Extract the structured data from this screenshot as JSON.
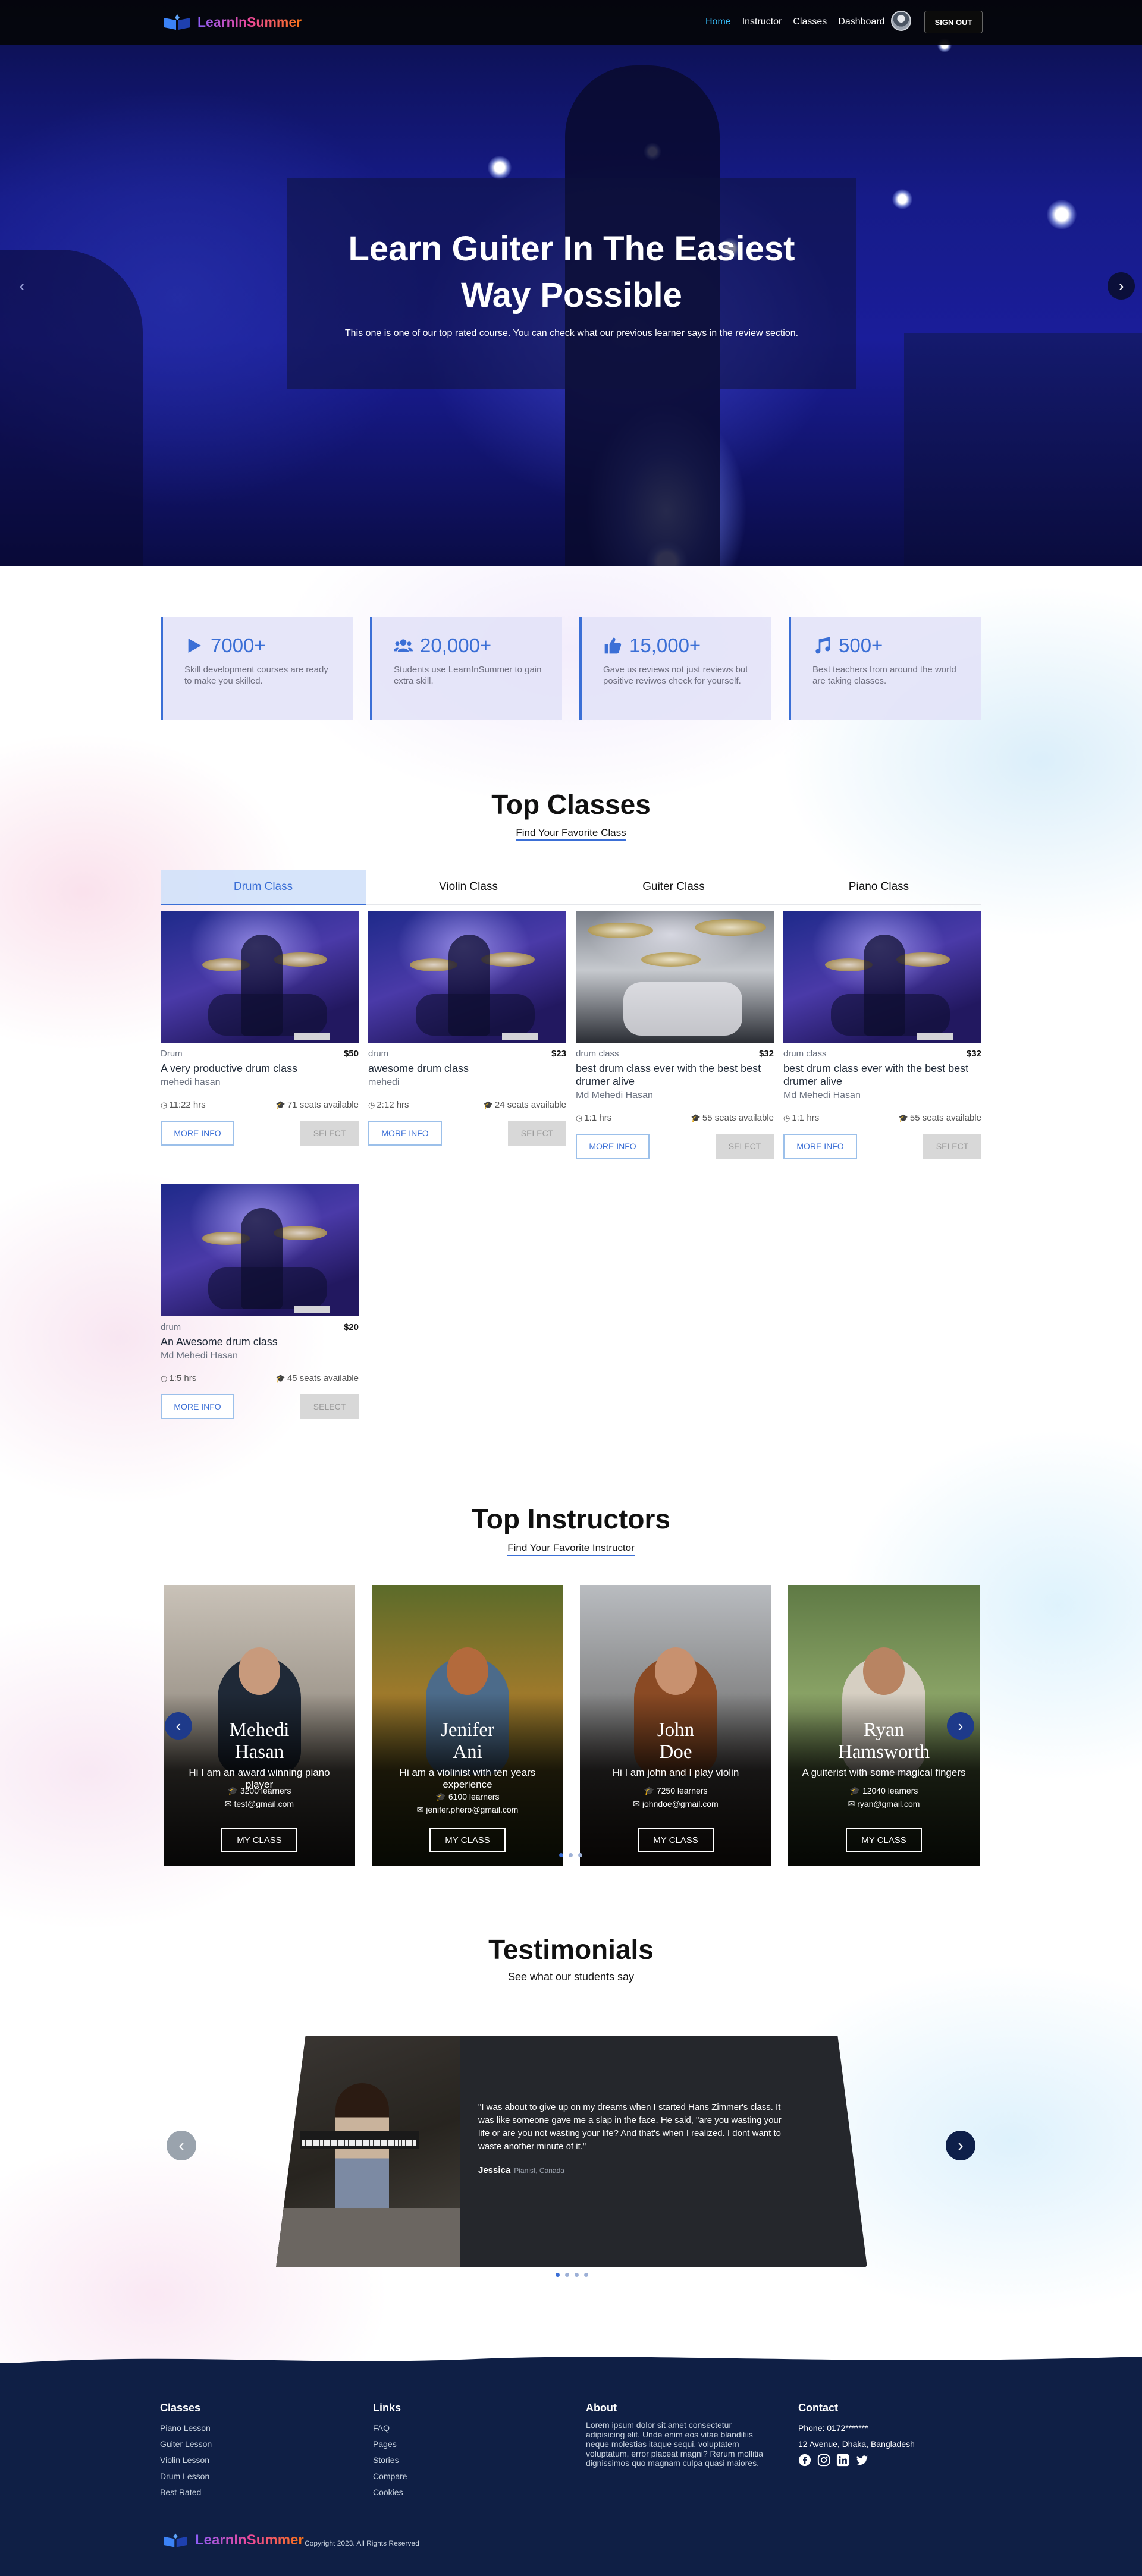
{
  "brand": {
    "name": "LearnInSummer"
  },
  "nav": {
    "links": [
      "Home",
      "Instructor",
      "Classes",
      "Dashboard"
    ],
    "active": "Home",
    "signout_label": "SIGN OUT"
  },
  "hero": {
    "title": "Learn Guiter In The Easiest\nWay Possible",
    "subtitle": "This one is one of our top rated course. You can check what our previous learner says in the review section."
  },
  "stats": [
    {
      "icon": "play-icon",
      "value": "7000+",
      "desc": "Skill development courses are ready to make you skilled."
    },
    {
      "icon": "users-icon",
      "value": "20,000+",
      "desc": "Students use LearnInSummer to gain extra skill."
    },
    {
      "icon": "thumbs-up-icon",
      "value": "15,000+",
      "desc": "Gave us reviews not just reviews but positive reviwes check for yourself."
    },
    {
      "icon": "music-icon",
      "value": "500+",
      "desc": "Best teachers from around the world are taking classes."
    }
  ],
  "top_classes": {
    "title": "Top Classes",
    "subtitle": "Find Your Favorite Class",
    "tabs": [
      "Drum Class",
      "Violin Class",
      "Guiter Class",
      "Piano Class"
    ],
    "active_tab": "Drum Class",
    "cards": [
      {
        "category": "Drum",
        "price": "$50",
        "name": "A very productive drum class",
        "instructor": "mehedi hasan",
        "duration": "11:22 hrs",
        "seats": "71 seats available",
        "more": "MORE INFO",
        "select": "SELECT"
      },
      {
        "category": "drum",
        "price": "$23",
        "name": "awesome drum class",
        "instructor": "mehedi",
        "duration": "2:12 hrs",
        "seats": "24 seats available",
        "more": "MORE INFO",
        "select": "SELECT"
      },
      {
        "category": "drum class",
        "price": "$32",
        "name": "best drum class ever with the best best drumer alive",
        "instructor": "Md Mehedi Hasan",
        "duration": "1:1 hrs",
        "seats": "55 seats available",
        "more": "MORE INFO",
        "select": "SELECT"
      },
      {
        "category": "drum class",
        "price": "$32",
        "name": "best drum class ever with the best best drumer alive",
        "instructor": "Md Mehedi Hasan",
        "duration": "1:1 hrs",
        "seats": "55 seats available",
        "more": "MORE INFO",
        "select": "SELECT"
      },
      {
        "category": "drum",
        "price": "$20",
        "name": "An Awesome drum class",
        "instructor": "Md Mehedi Hasan",
        "duration": "1:5 hrs",
        "seats": "45 seats available",
        "more": "MORE INFO",
        "select": "SELECT"
      }
    ]
  },
  "top_instructors": {
    "title": "Top Instructors",
    "subtitle": "Find Your Favorite Instructor",
    "items": [
      {
        "name": "Mehedi\nHasan",
        "bio": "Hi I am an award winning piano player",
        "learners": "3200 learners",
        "email": "test@gmail.com",
        "button": "MY CLASS"
      },
      {
        "name": "Jenifer\nAni",
        "bio": "Hi am a violinist with ten years experience",
        "learners": "6100 learners",
        "email": "jenifer.phero@gmail.com",
        "button": "MY CLASS"
      },
      {
        "name": "John\nDoe",
        "bio": "Hi I am john and I play violin",
        "learners": "7250 learners",
        "email": "johndoe@gmail.com",
        "button": "MY CLASS"
      },
      {
        "name": "Ryan\nHamsworth",
        "bio": "A guiterist with some magical fingers",
        "learners": "12040 learners",
        "email": "ryan@gmail.com",
        "button": "MY CLASS"
      }
    ]
  },
  "testimonials": {
    "title": "Testimonials",
    "subtitle": "See what our students say",
    "quote": "\"I was about to give up on my dreams when I started Hans Zimmer's class. It was like someone gave me a slap in the face. He said, \"are you wasting your life or are you not wasting your life? And that's when I realized. I dont want to waste another minute of it.\"",
    "author": "Jessica",
    "location": "Pianist, Canada"
  },
  "footer": {
    "classes_title": "Classes",
    "classes": [
      "Piano Lesson",
      "Guiter Lesson",
      "Violin Lesson",
      "Drum Lesson",
      "Best Rated"
    ],
    "links_title": "Links",
    "links": [
      "FAQ",
      "Pages",
      "Stories",
      "Compare",
      "Cookies"
    ],
    "about_title": "About",
    "about_text": "Lorem ipsum dolor sit amet consectetur adipisicing elit. Unde enim eos vitae blanditiis neque molestias itaque sequi, voluptatem voluptatum, error placeat magni? Rerum mollitia dignissimos quo magnam culpa quasi maiores.",
    "contact_title": "Contact",
    "phone": "Phone: 0172*******",
    "address": "12 Avenue, Dhaka, Bangladesh",
    "copyright": "Copyright 2023. All Rights Reserved"
  },
  "colors": {
    "accent": "#3b6fd6",
    "footer_bg": "#0f1f45",
    "hero": "#161b88"
  }
}
